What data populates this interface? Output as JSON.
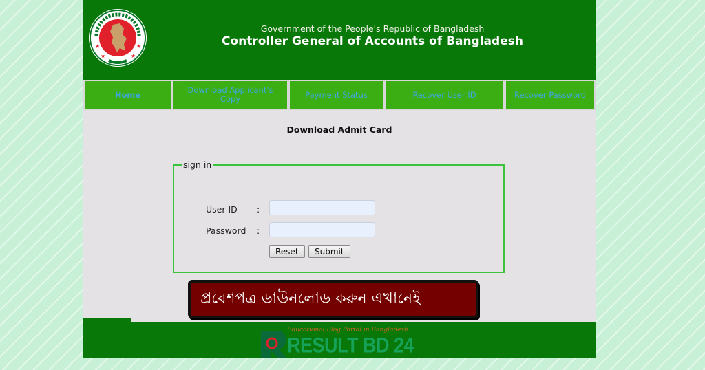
{
  "header": {
    "emblem": "bangladesh-government-seal",
    "gov_line": "Government of the People's Republic of Bangladesh",
    "org_title": "Controller General of Accounts of Bangladesh"
  },
  "nav": {
    "items": [
      {
        "label": "Home",
        "active": true
      },
      {
        "label": "Download Applicant's Copy",
        "active": false
      },
      {
        "label": "Payment Status",
        "active": false
      },
      {
        "label": "Recover User ID",
        "active": false
      },
      {
        "label": "Recover Password",
        "active": false
      }
    ]
  },
  "content": {
    "title": "Download Admit Card",
    "form": {
      "legend": "sign in",
      "user_id_label": "User ID",
      "password_label": "Password",
      "separator": ":",
      "user_id_value": "",
      "password_value": "",
      "reset_label": "Reset",
      "submit_label": "Submit"
    }
  },
  "banner": {
    "text": "প্রবেশপত্র ডাউনলোড করুন এখানেই"
  },
  "footer": {
    "logo_tagline": "Educational Blog Portal in Bangladesh",
    "logo_name": "RESULT BD 24"
  },
  "colors": {
    "header_green": "#087808",
    "nav_green": "#3aae12",
    "nav_text": "#40a8e0",
    "fieldset_border": "#3cc33c",
    "banner_bg": "#750000"
  }
}
